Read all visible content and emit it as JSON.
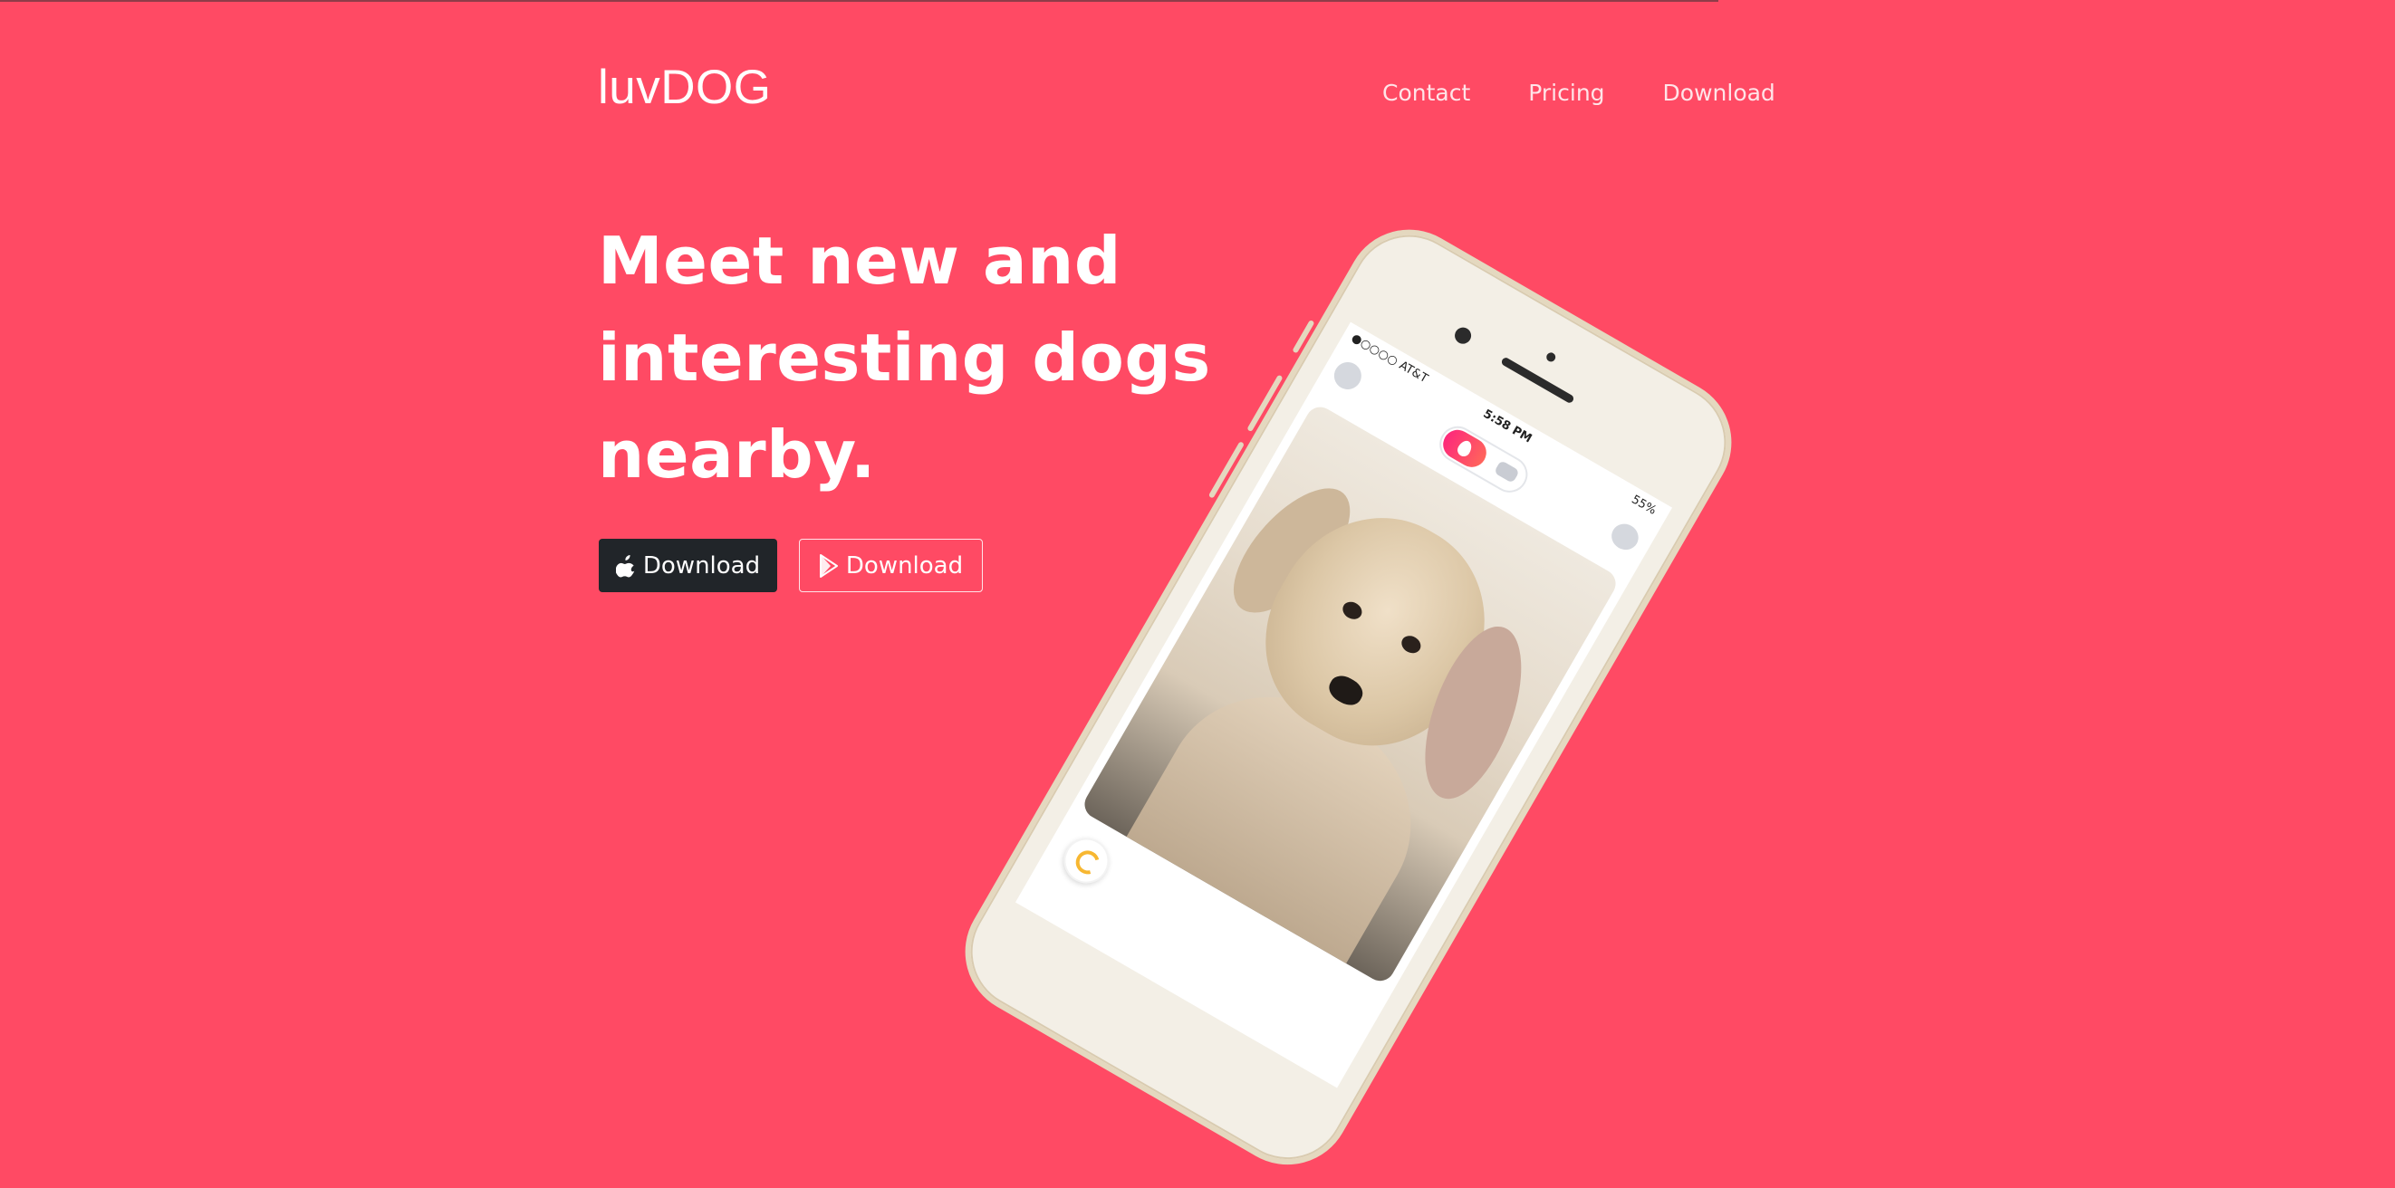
{
  "brand": {
    "name": "luvDOG"
  },
  "nav": {
    "items": [
      "Contact",
      "Pricing",
      "Download"
    ]
  },
  "hero": {
    "headline_lines": [
      "Meet new and",
      "interesting dogs",
      "nearby."
    ],
    "buttons": {
      "apple_label": "Download",
      "play_label": "Download"
    }
  },
  "phone": {
    "carrier": "●○○○○ AT&T",
    "time": "5:58 PM",
    "battery": "55%"
  },
  "colors": {
    "background": "#ff4a64",
    "apple_button": "#212529",
    "accent_gradient_start": "#fd297b",
    "accent_gradient_end": "#ff655b"
  },
  "icons": [
    "apple-icon",
    "google-play-icon",
    "profile-icon",
    "flame-icon",
    "chat-icon",
    "refresh-icon"
  ]
}
